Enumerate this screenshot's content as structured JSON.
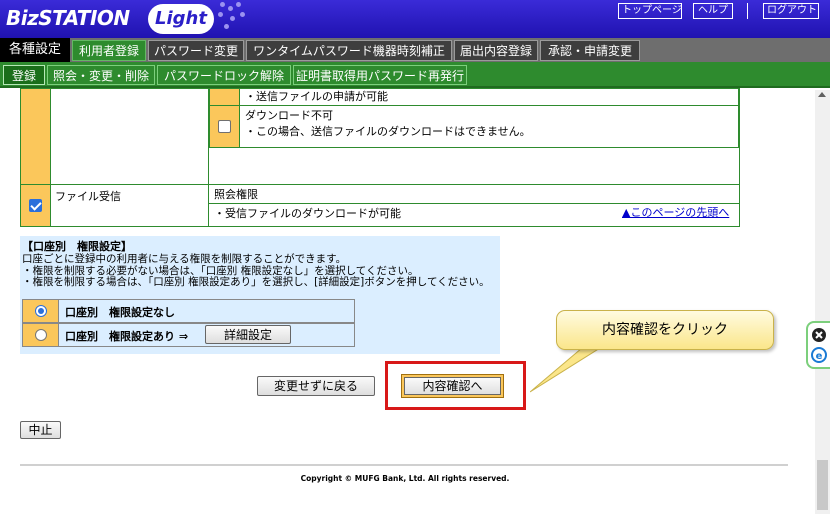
{
  "header": {
    "logo": "BizSTATION",
    "logo_sub": "Light",
    "links": [
      "トップページ",
      "ヘルプ",
      "ログアウト"
    ]
  },
  "menu1": {
    "label": "各種設定",
    "items": [
      "利用者登録",
      "パスワード変更",
      "ワンタイムパスワード機器時刻補正",
      "届出内容登録",
      "承認・申請変更"
    ]
  },
  "menu2": {
    "items": [
      "登録",
      "照会・変更・削除",
      "パスワードロック解除",
      "証明書取得用パスワード再発行"
    ]
  },
  "permissions": {
    "partial_line": "・送信ファイルの申請が可能",
    "download_label": "ダウンロード不可",
    "download_desc": "・この場合、送信ファイルのダウンロードはできません。",
    "file_receive_label": "ファイル受信",
    "file_receive_sub": "照会権限",
    "file_receive_desc": "・受信ファイルのダウンロードが可能"
  },
  "top_link": "▲このページの先頭へ",
  "account": {
    "title": "【口座別　権限設定】",
    "desc": "口座ごとに登録中の利用者に与える権限を制限することができます。\n・権限を制限する必要がない場合は、「口座別 権限設定なし」を選択してください。\n・権限を制限する場合は、「口座別 権限設定あり」を選択し、[詳細設定]ボタンを押してください。",
    "option_none": "口座別　権限設定なし",
    "option_some": "口座別　権限設定あり ⇒",
    "detail_button": "詳細設定"
  },
  "buttons": {
    "back": "変更せずに戻る",
    "confirm": "内容確認へ",
    "cancel": "中止"
  },
  "callout": "内容確認をクリック",
  "copyright": "Copyright © MUFG Bank, Ltd. All rights reserved.",
  "colors": {
    "header": "#2b1fc8",
    "menu_active": "#2e8b2e",
    "check_cell": "#fbc75b",
    "highlight": "#d81818"
  }
}
